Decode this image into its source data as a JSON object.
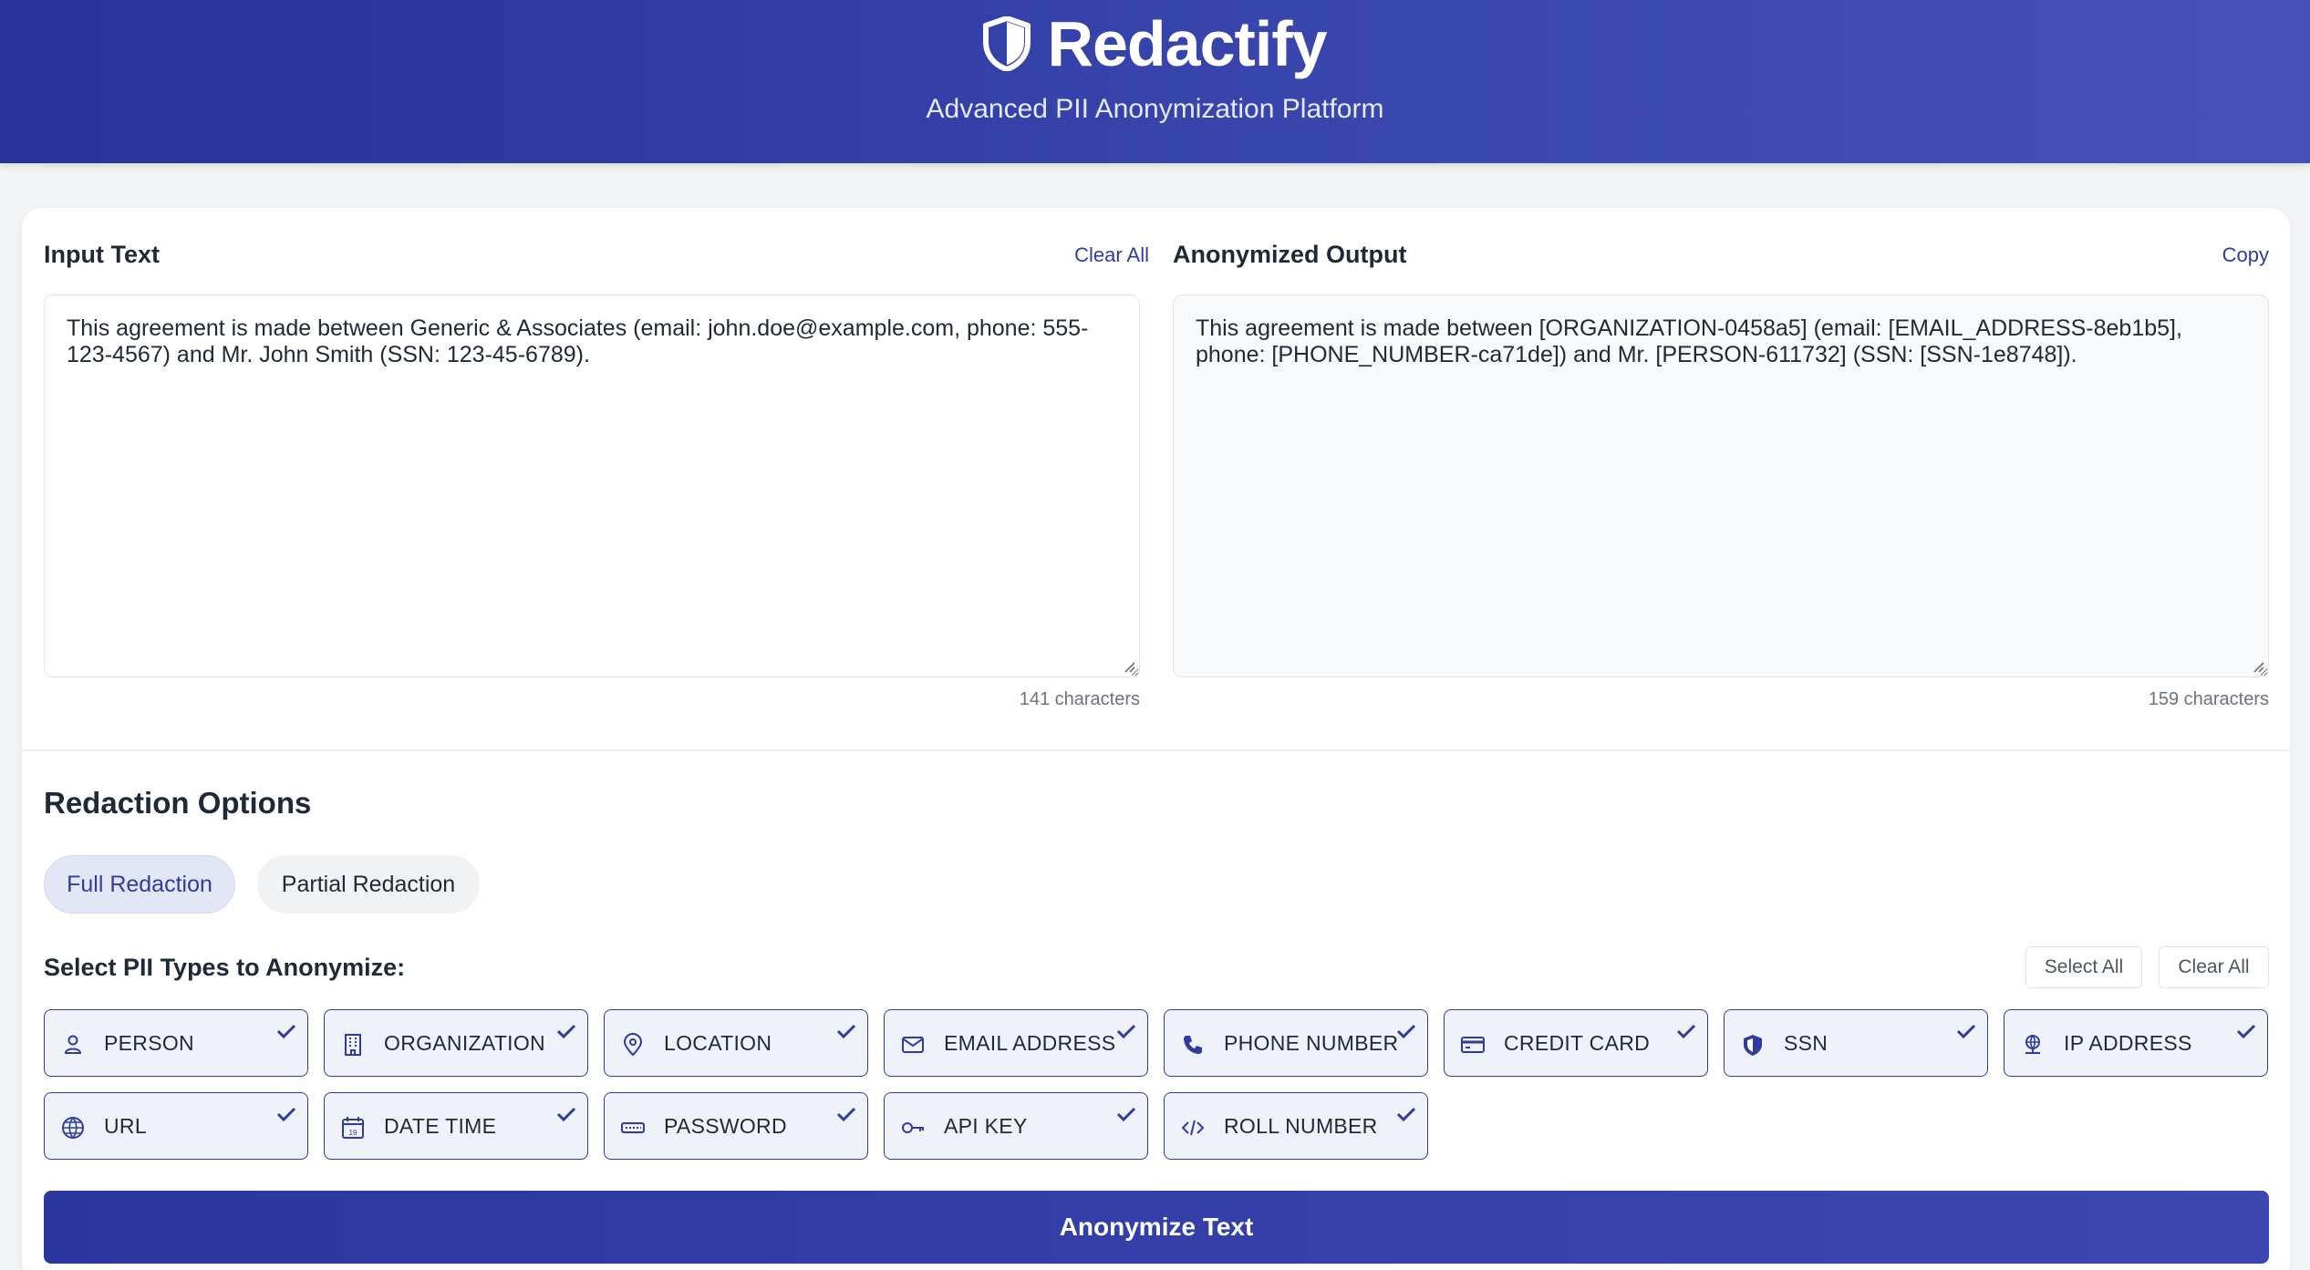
{
  "header": {
    "title": "Redactify",
    "subtitle": "Advanced PII Anonymization Platform",
    "logo_icon": "shield-icon"
  },
  "input": {
    "title": "Input Text",
    "clear_label": "Clear All",
    "text": "This agreement is made between Generic & Associates (email: john.doe@example.com, phone: 555-123-4567) and Mr. John Smith (SSN: 123-45-6789).",
    "count": "141 characters"
  },
  "output": {
    "title": "Anonymized Output",
    "copy_label": "Copy",
    "text": "This agreement is made between [ORGANIZATION-0458a5] (email: [EMAIL_ADDRESS-8eb1b5], phone: [PHONE_NUMBER-ca71de]) and Mr. [PERSON-611732] (SSN: [SSN-1e8748]).",
    "count": "159 characters"
  },
  "options": {
    "title": "Redaction Options",
    "modes": [
      {
        "label": "Full Redaction",
        "active": true
      },
      {
        "label": "Partial Redaction",
        "active": false
      }
    ],
    "pii_title": "Select PII Types to Anonymize:",
    "select_all_label": "Select All",
    "clear_all_label": "Clear All",
    "pii_types": [
      {
        "label": "PERSON",
        "icon": "person-icon",
        "checked": true
      },
      {
        "label": "ORGANIZATION",
        "icon": "building-icon",
        "checked": true
      },
      {
        "label": "LOCATION",
        "icon": "location-pin-icon",
        "checked": true
      },
      {
        "label": "EMAIL ADDRESS",
        "icon": "envelope-icon",
        "checked": true
      },
      {
        "label": "PHONE NUMBER",
        "icon": "phone-icon",
        "checked": true
      },
      {
        "label": "CREDIT CARD",
        "icon": "credit-card-icon",
        "checked": true
      },
      {
        "label": "SSN",
        "icon": "shield-icon",
        "checked": true
      },
      {
        "label": "IP ADDRESS",
        "icon": "network-icon",
        "checked": true
      },
      {
        "label": "URL",
        "icon": "globe-icon",
        "checked": true
      },
      {
        "label": "DATE TIME",
        "icon": "calendar-icon",
        "checked": true
      },
      {
        "label": "PASSWORD",
        "icon": "password-icon",
        "checked": true
      },
      {
        "label": "API KEY",
        "icon": "key-icon",
        "checked": true
      },
      {
        "label": "ROLL NUMBER",
        "icon": "code-icon",
        "checked": true
      }
    ]
  },
  "action": {
    "label": "Anonymize Text"
  },
  "colors": {
    "accent": "#2f3c9e",
    "header_start": "#26319a",
    "header_end": "#4550b8"
  }
}
